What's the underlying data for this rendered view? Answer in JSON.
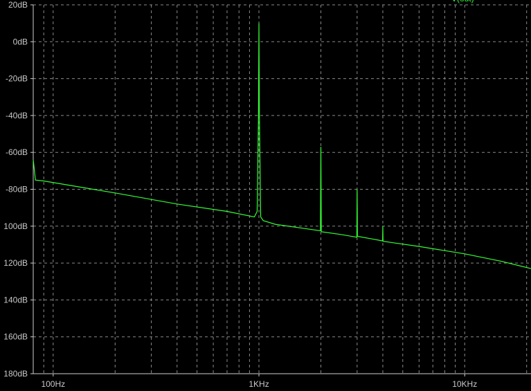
{
  "chart_data": {
    "type": "line",
    "xscale": "log",
    "xlim": [
      80,
      21000
    ],
    "ylim": [
      -180,
      20
    ],
    "ylabel_unit": "dB",
    "grid": true,
    "legend_position": "top-right",
    "y_ticks": [
      "20dB",
      "0dB",
      "-20dB",
      "-40dB",
      "-60dB",
      "-80dB",
      "100dB",
      "120dB",
      "140dB",
      "160dB",
      "180dB"
    ],
    "y_tick_values": [
      20,
      0,
      -20,
      -40,
      -60,
      -80,
      -100,
      -120,
      -140,
      -160,
      -180
    ],
    "x_ticks": [
      "100Hz",
      "1KHz",
      "10KHz"
    ],
    "x_tick_values": [
      100,
      1000,
      10000
    ],
    "series": [
      {
        "name": "V(out)",
        "color": "#33ff33",
        "x": [
          80,
          82,
          90,
          200,
          400,
          700,
          950,
          980,
          995,
          1000,
          1005,
          1020,
          1050,
          1200,
          1600,
          1990,
          1995,
          2000,
          2005,
          2010,
          2500,
          2990,
          2995,
          3000,
          3005,
          3010,
          3500,
          3990,
          3995,
          4000,
          4005,
          4010,
          4500,
          6000,
          10000,
          15000,
          21000
        ],
        "y": [
          -64,
          -75,
          -75.5,
          -82,
          -88,
          -92,
          -95,
          -92,
          -40,
          10,
          -40,
          -95,
          -97,
          -99,
          -101,
          -102.5,
          -80,
          -57,
          -80,
          -103,
          -104.5,
          -106,
          -92,
          -80,
          -92,
          -105.5,
          -106.8,
          -108,
          -104,
          -100,
          -104,
          -108.2,
          -109,
          -111,
          -115,
          -119,
          -123
        ]
      }
    ]
  }
}
